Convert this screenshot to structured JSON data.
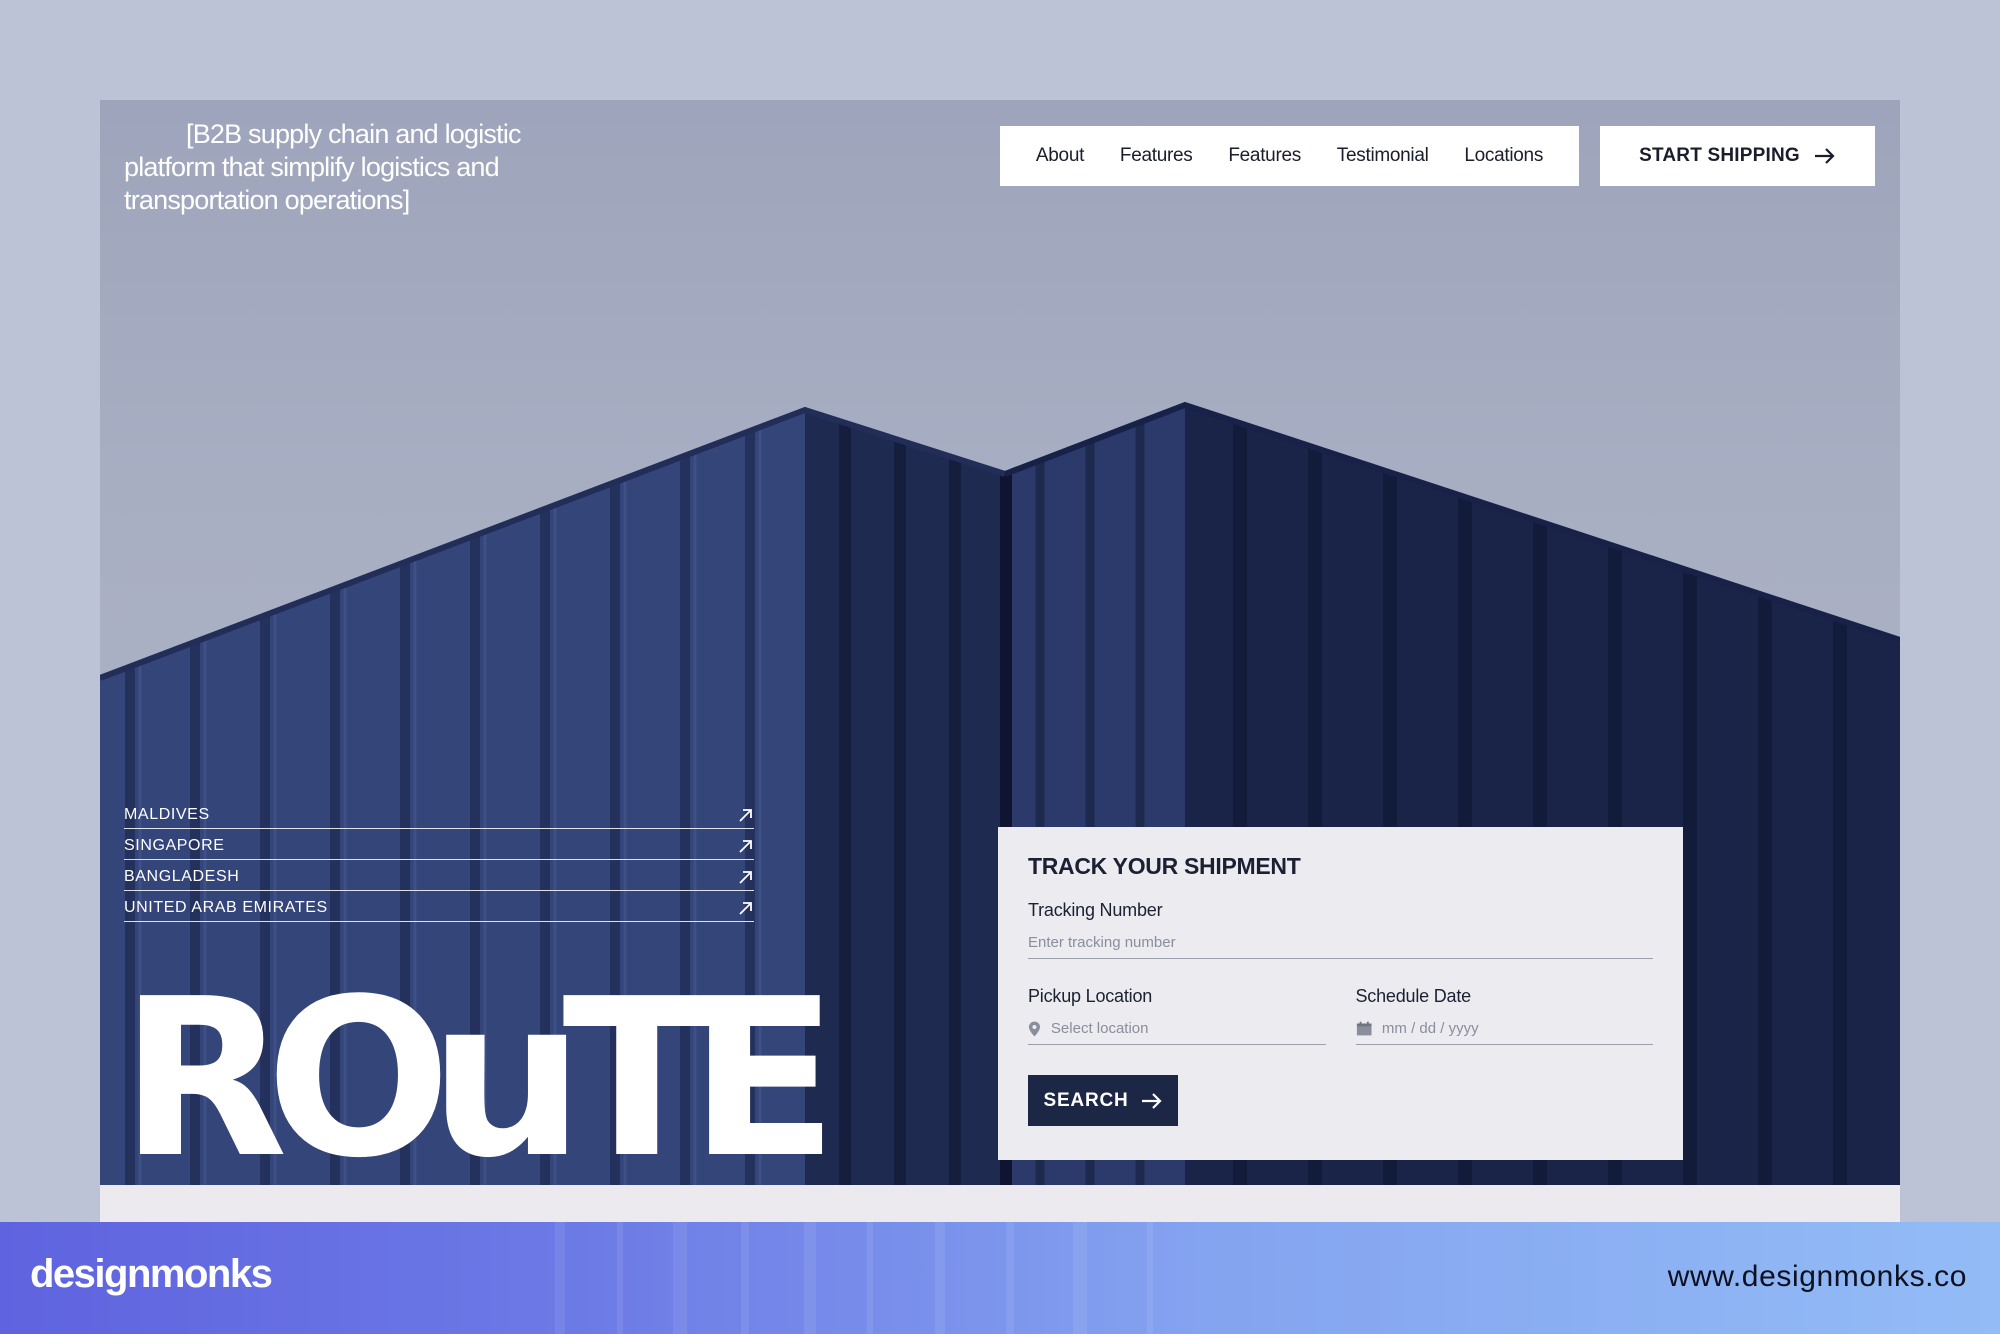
{
  "hero": {
    "tagline": "[B2B supply chain and logistic platform that simplify logistics and transportation operations]",
    "logo": "ROuTE"
  },
  "nav": {
    "items": [
      "About",
      "Features",
      "Features",
      "Testimonial",
      "Locations"
    ],
    "cta": "START SHIPPING"
  },
  "destinations": [
    "MALDIVES",
    "SINGAPORE",
    "BANGLADESH",
    "UNITED ARAB EMIRATES"
  ],
  "track": {
    "title": "TRACK YOUR SHIPMENT",
    "tracking_label": "Tracking Number",
    "tracking_placeholder": "Enter tracking number",
    "pickup_label": "Pickup Location",
    "pickup_placeholder": "Select location",
    "date_label": "Schedule Date",
    "date_placeholder": "mm / dd / yyyy",
    "search_label": "SEARCH"
  },
  "footer": {
    "brand": "designmonks",
    "url": "www.designmonks.co"
  },
  "colors": {
    "page_bg": "#bcc3d6",
    "container_navy": "#2d3b6b",
    "panel_bg": "#ecebf0",
    "button_navy": "#1c2746"
  },
  "icons": [
    "arrow-right-icon",
    "arrow-up-right-icon",
    "map-pin-icon",
    "calendar-icon"
  ]
}
